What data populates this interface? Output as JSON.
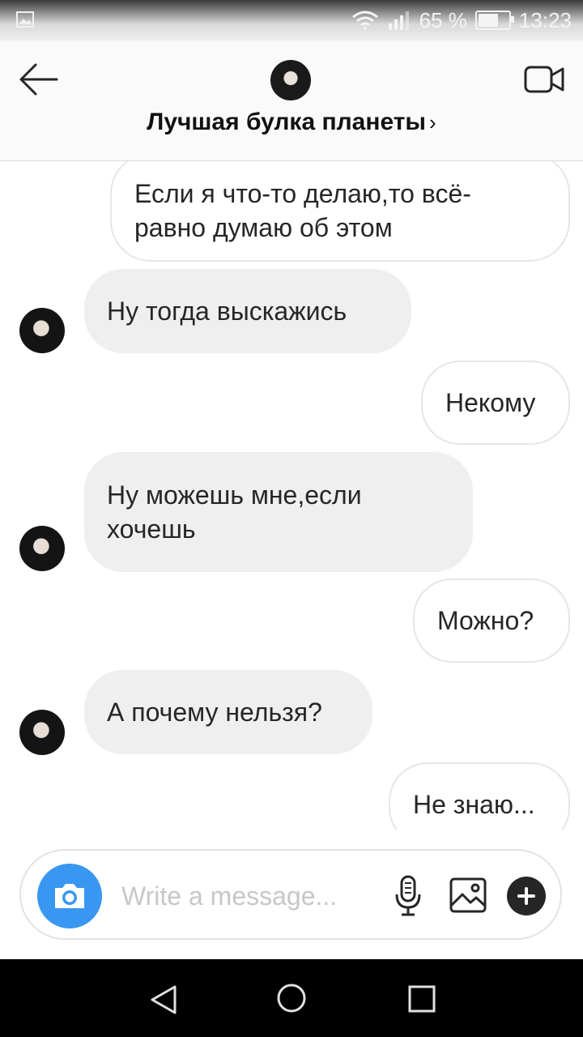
{
  "status_bar": {
    "battery": "65 %",
    "time": "13:23"
  },
  "header": {
    "title": "Лучшая булка планеты",
    "chevron": "›"
  },
  "messages": [
    {
      "side": "out",
      "text": "Если я что-то делаю,то всё-\nравно думаю об этом"
    },
    {
      "side": "in",
      "text": "Ну тогда выскажись"
    },
    {
      "side": "out",
      "text": "Некому"
    },
    {
      "side": "in",
      "text": "Ну можешь мне,если\nхочешь"
    },
    {
      "side": "out",
      "text": "Можно?"
    },
    {
      "side": "in",
      "text": "А почему нельзя?"
    },
    {
      "side": "out",
      "text": "Не знаю..."
    }
  ],
  "composer": {
    "placeholder": "Write a message..."
  },
  "icons": {
    "back": "arrow-left-icon",
    "video": "video-camera-icon",
    "camera": "camera-icon",
    "mic": "microphone-icon",
    "gallery": "image-icon",
    "plus": "plus-icon"
  },
  "colors": {
    "accent": "#3897f0",
    "incoming_bubble": "#efefef",
    "outgoing_border": "#e6e6e6"
  }
}
